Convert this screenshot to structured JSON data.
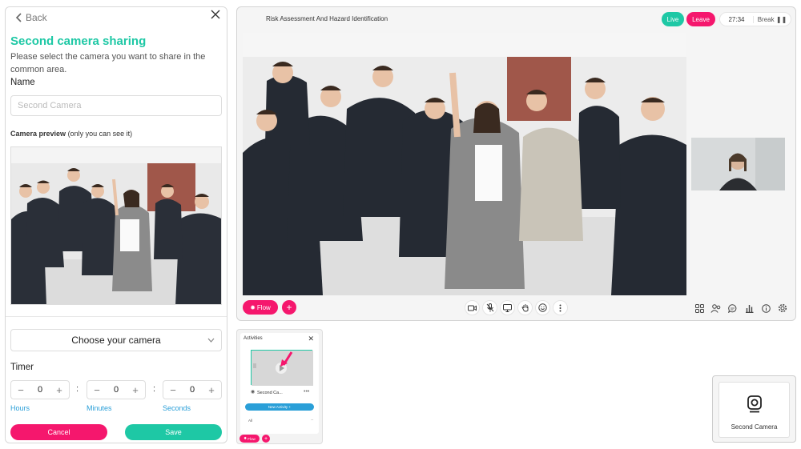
{
  "left_panel": {
    "back_label": "Back",
    "title": "Second camera sharing",
    "description": "Please select the camera you want to share in the common area.",
    "name_label": "Name",
    "name_placeholder": "Second Camera",
    "preview_label_bold": "Camera preview",
    "preview_label_note": "(only you can see it)",
    "camera_select_label": "Choose your camera",
    "timer_label": "Timer",
    "timer": [
      {
        "value": "0",
        "unit": "Hours"
      },
      {
        "value": "0",
        "unit": "Minutes"
      },
      {
        "value": "0",
        "unit": "Seconds"
      }
    ],
    "cancel_label": "Cancel",
    "save_label": "Save"
  },
  "meeting": {
    "title": "Risk Assessment And Hazard Identification",
    "live_label": "Live",
    "leave_label": "Leave",
    "timer": "27:34",
    "break_label": "Break",
    "flow_label": "Flow",
    "controls": [
      "camera-icon",
      "mic-off-icon",
      "screen-share-icon",
      "raise-hand-icon",
      "emoji-icon",
      "more-icon"
    ],
    "tools": [
      "grid-icon",
      "participants-icon",
      "chat-icon",
      "poll-icon",
      "info-icon",
      "settings-icon"
    ]
  },
  "activities": {
    "title": "Activities",
    "item_label": "Second Ca...",
    "new_activity_label": "New Activity +",
    "all_label": "All",
    "all_dash": "--",
    "flow_label": "Flow"
  },
  "second_camera_tile": {
    "label": "Second Camera"
  },
  "colors": {
    "accent_green": "#1ec8a5",
    "accent_pink": "#f5176d",
    "accent_blue": "#2a9fd8"
  }
}
